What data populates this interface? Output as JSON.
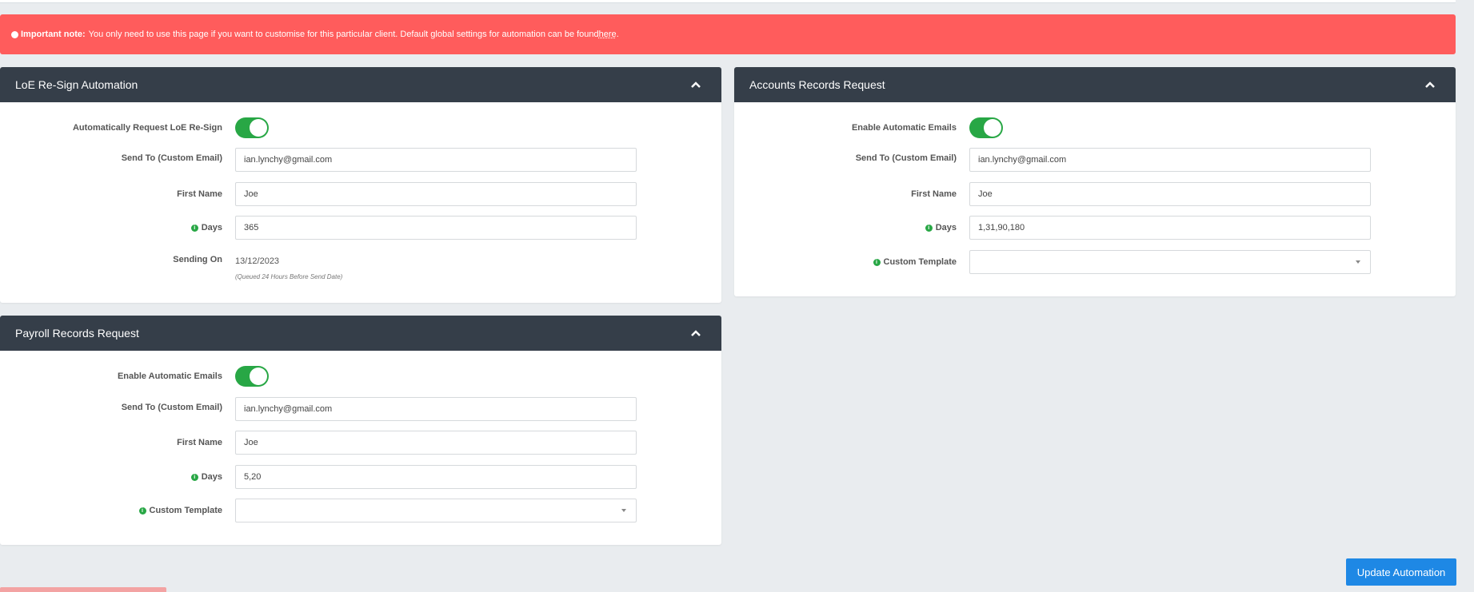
{
  "alert": {
    "bold": "Important note:",
    "text": "You only need to use this page if you want to customise for this particular client. Default global settings for automation can be found ",
    "link": "here",
    "end": "."
  },
  "loe_panel": {
    "title": "LoE Re-Sign Automation",
    "toggle_label": "Automatically Request LoE Re-Sign",
    "toggle_on": true,
    "send_to_label": "Send To (Custom Email)",
    "send_to_value": "ian.lynchy@gmail.com",
    "first_name_label": "First Name",
    "first_name_value": "Joe",
    "days_label": "Days",
    "days_value": "365",
    "sending_on_label": "Sending On",
    "sending_on_value": "13/12/2023",
    "sending_on_note": "(Queued 24 Hours Before Send Date)"
  },
  "accounts_panel": {
    "title": "Accounts Records Request",
    "toggle_label": "Enable Automatic Emails",
    "toggle_on": true,
    "send_to_label": "Send To (Custom Email)",
    "send_to_value": "ian.lynchy@gmail.com",
    "first_name_label": "First Name",
    "first_name_value": "Joe",
    "days_label": "Days",
    "days_value": "1,31,90,180",
    "template_label": "Custom Template",
    "template_value": ""
  },
  "payroll_panel": {
    "title": "Payroll Records Request",
    "toggle_label": "Enable Automatic Emails",
    "toggle_on": true,
    "send_to_label": "Send To (Custom Email)",
    "send_to_value": "ian.lynchy@gmail.com",
    "first_name_label": "First Name",
    "first_name_value": "Joe",
    "days_label": "Days",
    "days_value": "5,20",
    "template_label": "Custom Template",
    "template_value": ""
  },
  "update_button": "Update Automation",
  "colors": {
    "alert": "#ff5c5c",
    "header": "#353e49",
    "toggle": "#28a745",
    "primary": "#1e88e5"
  }
}
